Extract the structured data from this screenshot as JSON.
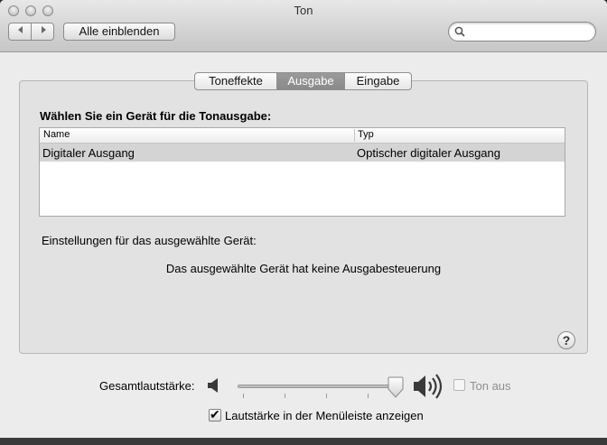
{
  "window": {
    "title": "Ton"
  },
  "toolbar": {
    "back_icon": "back-arrow-icon",
    "forward_icon": "forward-arrow-icon",
    "show_all_label": "Alle einblenden",
    "search_placeholder": "",
    "search_value": ""
  },
  "tabs": [
    {
      "label": "Toneffekte",
      "active": false
    },
    {
      "label": "Ausgabe",
      "active": true
    },
    {
      "label": "Eingabe",
      "active": false
    }
  ],
  "output": {
    "heading": "Wählen Sie ein Gerät für die Tonausgabe:",
    "columns": [
      "Name",
      "Typ"
    ],
    "rows": [
      {
        "name": "Digitaler Ausgang",
        "type": "Optischer digitaler Ausgang",
        "selected": true
      }
    ],
    "settings_label": "Einstellungen für das ausgewählte Gerät:",
    "no_control_text": "Das ausgewählte Gerät hat keine Ausgabesteuerung"
  },
  "help_label": "?",
  "volume": {
    "label": "Gesamtlautstärke:",
    "level": 1.0,
    "mute_label": "Ton aus",
    "mute_checked": false,
    "mute_enabled": false
  },
  "menubar_option": {
    "label": "Lautstärke in der Menüleiste anzeigen",
    "checked": true
  },
  "colors": {
    "selected_tab": "#8e8e8e",
    "selected_row": "#d4d4d4",
    "panel": "#e2e2e2"
  }
}
